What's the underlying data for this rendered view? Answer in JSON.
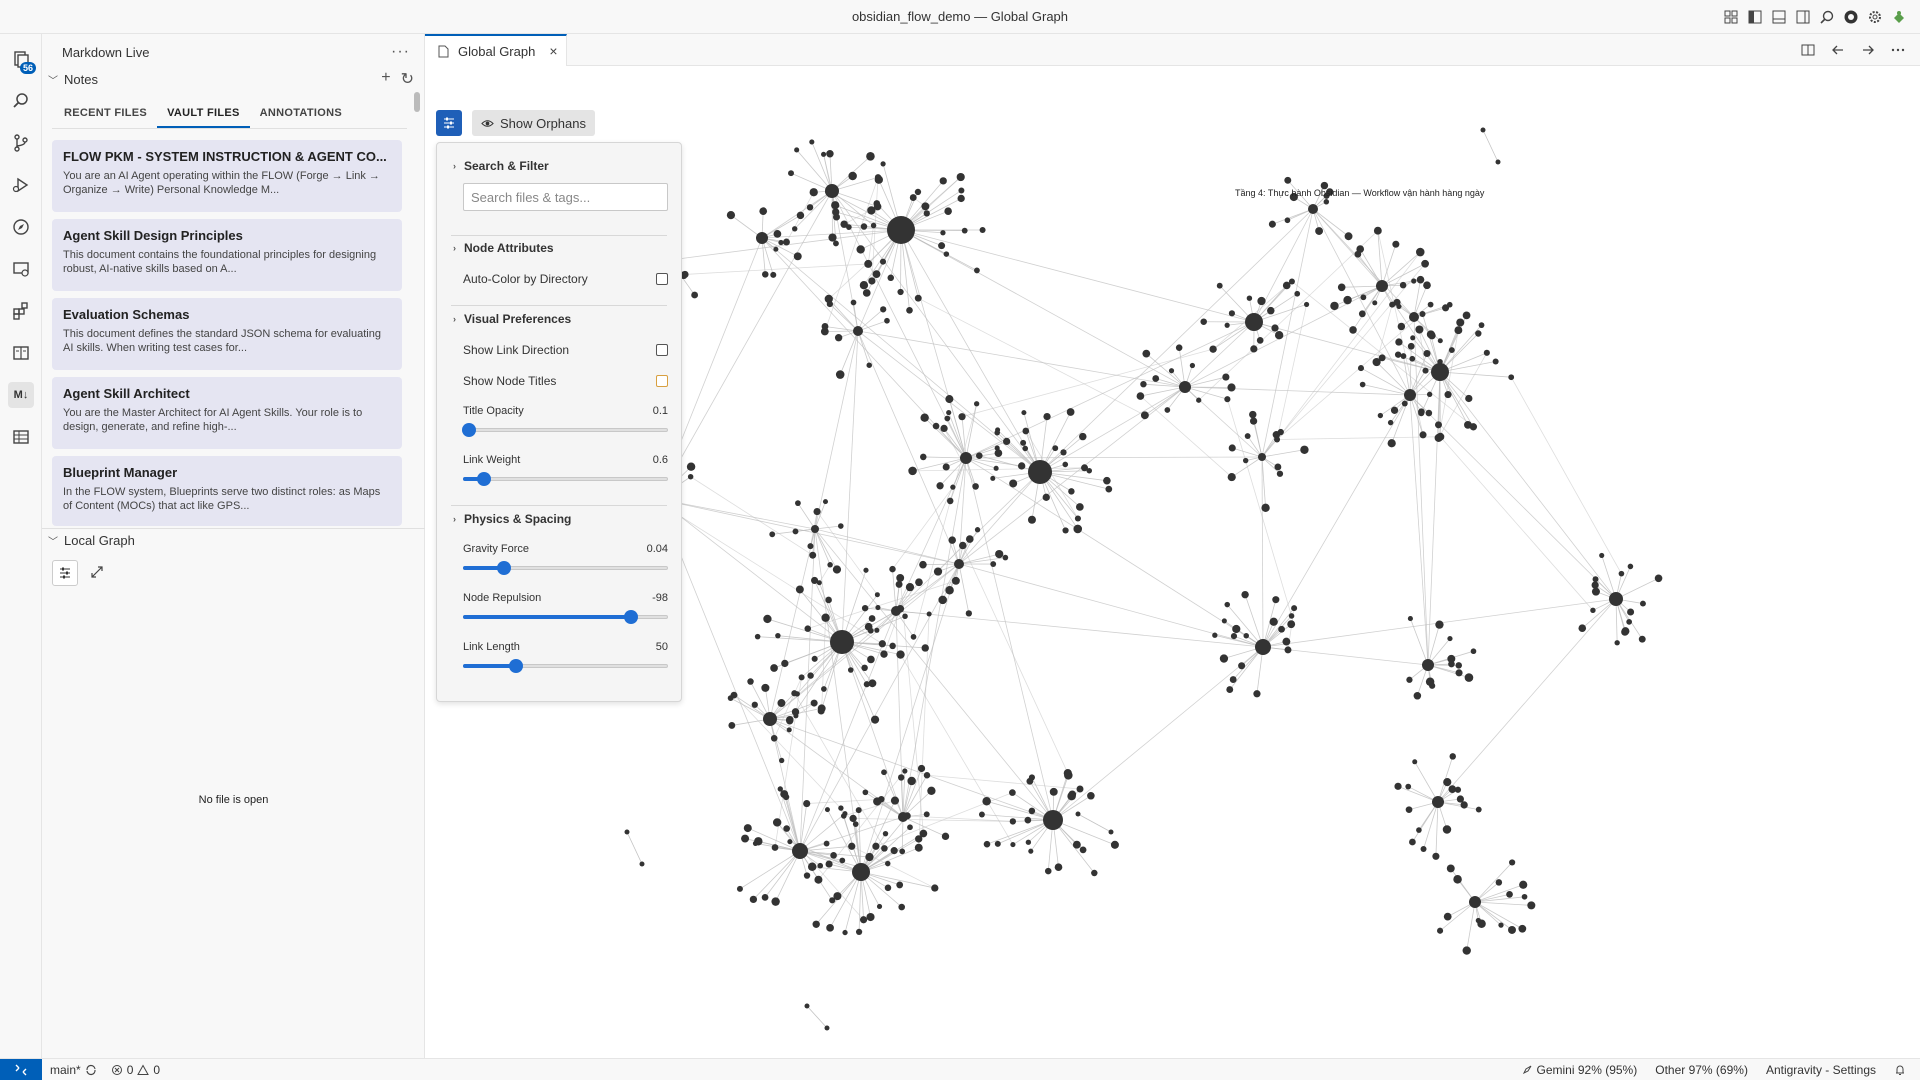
{
  "window": {
    "title": "obsidian_flow_demo — Global Graph"
  },
  "activity": {
    "badge_count": "56",
    "markdown_icon_label": "M↓"
  },
  "sidebar": {
    "header": "Markdown Live",
    "notes_section": "Notes",
    "tabs": [
      "RECENT FILES",
      "VAULT FILES",
      "ANNOTATIONS"
    ],
    "active_tab": "VAULT FILES",
    "cards": [
      {
        "title": "FLOW PKM - SYSTEM INSTRUCTION & AGENT CO...",
        "desc": "You are an AI Agent operating within the FLOW (Forge → Link → Organize → Write) Personal Knowledge M..."
      },
      {
        "title": "Agent Skill Design Principles",
        "desc": "This document contains the foundational principles for designing robust, AI-native skills based on A..."
      },
      {
        "title": "Evaluation Schemas",
        "desc": "This document defines the standard JSON schema for evaluating AI skills. When writing test cases for..."
      },
      {
        "title": "Agent Skill Architect",
        "desc": "You are the Master Architect for AI Agent Skills. Your role is to design, generate, and refine high-..."
      },
      {
        "title": "Blueprint Manager",
        "desc": "In the FLOW system, Blueprints serve two distinct roles: as Maps of Content (MOCs) that act like GPS..."
      }
    ],
    "local_graph_section": "Local Graph",
    "no_file_text": "No file is open"
  },
  "editor": {
    "tab_label": "Global Graph",
    "show_orphans_label": "Show Orphans",
    "graph_node_label": "Tầng 4: Thực hành Obsidian — Workflow vận hành hàng ngày"
  },
  "graph_panel": {
    "search_filter": "Search & Filter",
    "search_placeholder": "Search files & tags...",
    "node_attributes": "Node Attributes",
    "auto_color": "Auto-Color by Directory",
    "visual_preferences": "Visual Preferences",
    "show_link_direction": "Show Link Direction",
    "show_node_titles": "Show Node Titles",
    "title_opacity_label": "Title Opacity",
    "title_opacity_value": "0.1",
    "link_weight_label": "Link Weight",
    "link_weight_value": "0.6",
    "physics_spacing": "Physics & Spacing",
    "gravity_force_label": "Gravity Force",
    "gravity_force_value": "0.04",
    "node_repulsion_label": "Node Repulsion",
    "node_repulsion_value": "-98",
    "link_length_label": "Link Length",
    "link_length_value": "50",
    "slider_levels": {
      "title_opacity": 0.03,
      "link_weight": 0.1,
      "gravity_force": 0.2,
      "node_repulsion": 0.82,
      "link_length": 0.26
    }
  },
  "statusbar": {
    "branch": "main*",
    "errors": "0",
    "warnings": "0",
    "gemini": "Gemini 92% (95%)",
    "other": "Other 97% (69%)",
    "settings": "Antigravity - Settings"
  },
  "colors": {
    "accent": "#005fb8",
    "card_bg": "#e5e5f2",
    "node": "#333333",
    "edge": "#bdbdbd"
  }
}
